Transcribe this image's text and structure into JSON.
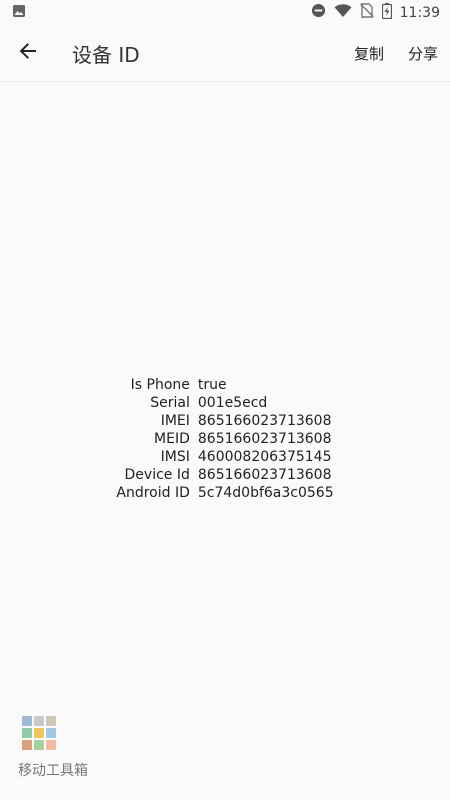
{
  "status": {
    "time": "11:39"
  },
  "appbar": {
    "title": "设备 ID",
    "copy_label": "复制",
    "share_label": "分享"
  },
  "device_info": [
    {
      "label": "Is Phone",
      "value": "true"
    },
    {
      "label": "Serial",
      "value": "001e5ecd"
    },
    {
      "label": "IMEI",
      "value": "865166023713608"
    },
    {
      "label": "MEID",
      "value": "865166023713608"
    },
    {
      "label": "IMSI",
      "value": "460008206375145"
    },
    {
      "label": "Device Id",
      "value": "865166023713608"
    },
    {
      "label": "Android ID",
      "value": "5c74d0bf6a3c0565"
    }
  ],
  "footer": {
    "app_name": "移动工具箱",
    "logo_colors": [
      "#9fb7d6",
      "#c9c9c9",
      "#cfc6b4",
      "#8fc8a6",
      "#f2c25b",
      "#9fc9e3",
      "#d9a07a",
      "#a7d0a0",
      "#f0b9a0"
    ]
  },
  "icons": [
    "image-icon",
    "dnd-icon",
    "wifi-icon",
    "no-sim-icon",
    "battery-charging-icon",
    "back-arrow-icon"
  ]
}
